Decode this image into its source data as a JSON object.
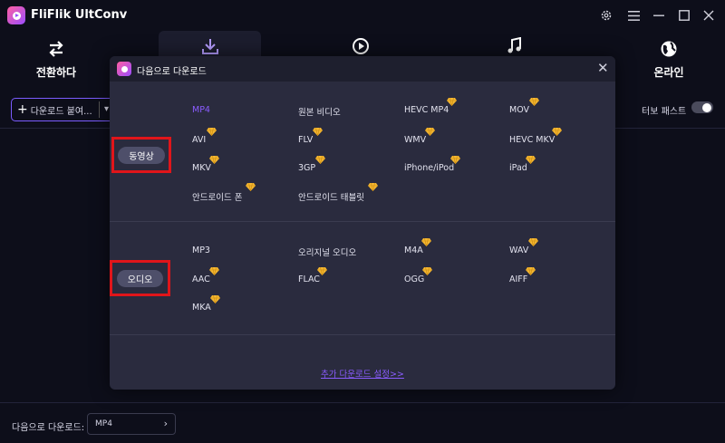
{
  "app": {
    "title": "FliFlik UltConv"
  },
  "window_controls": {
    "settings_icon": "gear-icon",
    "menu_icon": "menu-icon",
    "minimize_icon": "minimize-icon",
    "maximize_icon": "maximize-icon",
    "close_icon": "close-icon"
  },
  "nav": {
    "items": [
      {
        "label": "전환하다",
        "icon": "convert-arrows-icon"
      },
      {
        "label": "",
        "icon": "download-icon"
      },
      {
        "label": "",
        "icon": "play-circle-icon"
      },
      {
        "label": "",
        "icon": "music-note-icon"
      },
      {
        "label": "온라인",
        "icon": "globe-icon"
      }
    ]
  },
  "toolbar": {
    "paste_label": "다운로드 붙여...",
    "turbo_label": "터보 패스트"
  },
  "bottom": {
    "label": "다음으로 다운로드:",
    "selected": "MP4"
  },
  "modal": {
    "title": "다음으로 다운로드",
    "video_category": "동영상",
    "audio_category": "오디오",
    "video_formats": [
      {
        "label": "MP4",
        "premium": false,
        "selected": true
      },
      {
        "label": "원본 비디오",
        "premium": false
      },
      {
        "label": "HEVC MP4",
        "premium": true
      },
      {
        "label": "MOV",
        "premium": true
      },
      {
        "label": "AVI",
        "premium": true
      },
      {
        "label": "FLV",
        "premium": true
      },
      {
        "label": "WMV",
        "premium": true
      },
      {
        "label": "HEVC MKV",
        "premium": true
      },
      {
        "label": "MKV",
        "premium": true
      },
      {
        "label": "3GP",
        "premium": true
      },
      {
        "label": "iPhone/iPod",
        "premium": true
      },
      {
        "label": "iPad",
        "premium": true
      },
      {
        "label": "안드로이드 폰",
        "premium": true
      },
      {
        "label": "안드로이드 태블릿",
        "premium": true
      }
    ],
    "audio_formats": [
      {
        "label": "MP3",
        "premium": false
      },
      {
        "label": "오리지널 오디오",
        "premium": false
      },
      {
        "label": "M4A",
        "premium": true
      },
      {
        "label": "WAV",
        "premium": true
      },
      {
        "label": "AAC",
        "premium": true
      },
      {
        "label": "FLAC",
        "premium": true
      },
      {
        "label": "OGG",
        "premium": true
      },
      {
        "label": "AIFF",
        "premium": true
      },
      {
        "label": "MKA",
        "premium": true
      }
    ],
    "more_link": "추가 다운로드 설정>>"
  },
  "colors": {
    "accent": "#8a5cff",
    "highlight_box": "#e0151a",
    "premium_gem": "#f5b731"
  }
}
